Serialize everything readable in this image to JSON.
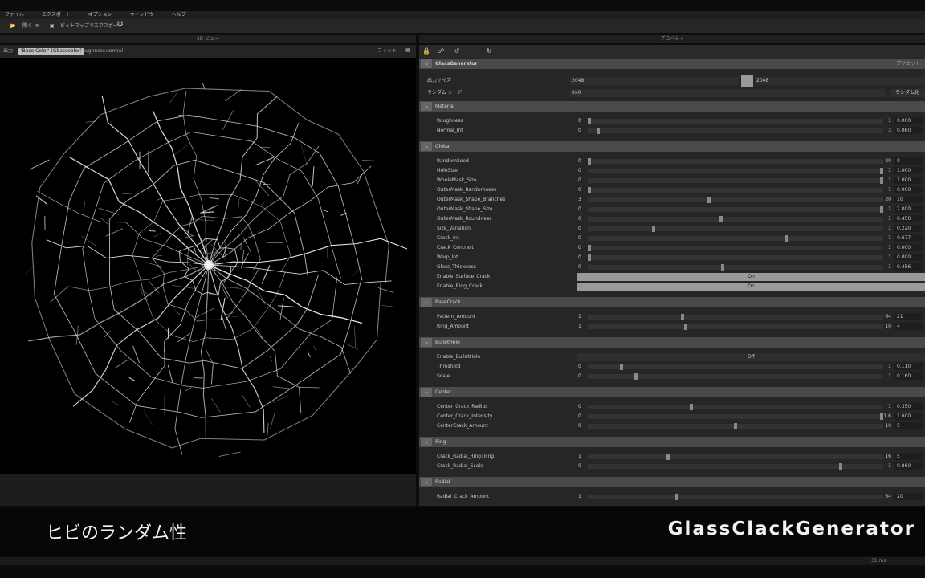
{
  "menu": [
    "ファイル",
    "エクスポート",
    "オプション",
    "ウィンドウ",
    "ヘルプ"
  ],
  "toolbar": {
    "open": "開く",
    "export": "ビットマップでエクスポート"
  },
  "left": {
    "title": "2D ビュー",
    "output_label": "出力",
    "output_chip": "'Base Color' (Gbasecolor)",
    "output_alt1": "roughness",
    "output_alt2": "normal",
    "fit": "フィット"
  },
  "right": {
    "title": "プロパティ",
    "graph": "GlassGenerator",
    "preset": "プリセット",
    "outsize_label": "出力サイズ",
    "outsize_a": "2048",
    "outsize_b": "2048",
    "seed_label": "ランダム シード",
    "seed_val": "0x0",
    "seed_btn": "ランダム化"
  },
  "sections": [
    {
      "name": "Material",
      "rows": [
        {
          "label": "Roughness",
          "min": "0",
          "max": "1",
          "value": "0.000",
          "pos": 0.0
        },
        {
          "label": "Normal_Int",
          "min": "0",
          "max": "3",
          "value": "0.080",
          "pos": 0.03
        }
      ]
    },
    {
      "name": "Global",
      "rows": [
        {
          "label": "RandomSeed",
          "min": "0",
          "max": "20",
          "value": "0",
          "pos": 0.0
        },
        {
          "label": "HoleSize",
          "min": "0",
          "max": "1",
          "value": "1.000",
          "pos": 1.0
        },
        {
          "label": "WholeMask_Size",
          "min": "0",
          "max": "1",
          "value": "1.000",
          "pos": 1.0
        },
        {
          "label": "OuterMask_Randomness",
          "min": "0",
          "max": "1",
          "value": "0.000",
          "pos": 0.0
        },
        {
          "label": "OuterMask_Shape_Branches",
          "min": "3",
          "max": "20",
          "value": "10",
          "pos": 0.41
        },
        {
          "label": "OuterMask_Shape_Size",
          "min": "0",
          "max": "2",
          "value": "2.000",
          "pos": 1.0
        },
        {
          "label": "OuterMask_Roundness",
          "min": "0",
          "max": "1",
          "value": "0.450",
          "pos": 0.45
        },
        {
          "label": "Size_Variation",
          "min": "0",
          "max": "1",
          "value": "0.220",
          "pos": 0.22
        },
        {
          "label": "Crack_Int",
          "min": "0",
          "max": "1",
          "value": "0.677",
          "pos": 0.677
        },
        {
          "label": "Crack_Contrast",
          "min": "0",
          "max": "1",
          "value": "0.000",
          "pos": 0.0
        },
        {
          "label": "Warp_Int",
          "min": "0",
          "max": "1",
          "value": "0.000",
          "pos": 0.0
        },
        {
          "label": "Glass_Thickness",
          "min": "0",
          "max": "1",
          "value": "0.456",
          "pos": 0.456
        },
        {
          "label": "Enable_Surface_Crack",
          "toggle": "On"
        },
        {
          "label": "Enable_Ring_Crack",
          "toggle": "On"
        }
      ]
    },
    {
      "name": "BaseCrack",
      "rows": [
        {
          "label": "Pattern_Amount",
          "min": "1",
          "max": "64",
          "value": "21",
          "pos": 0.32
        },
        {
          "label": "Ring_Amount",
          "min": "1",
          "max": "10",
          "value": "4",
          "pos": 0.33
        }
      ]
    },
    {
      "name": "BulletHole",
      "rows": [
        {
          "label": "Enable_BulletHole",
          "toggle": "Off"
        },
        {
          "label": "Threshold",
          "min": "0",
          "max": "1",
          "value": "0.110",
          "pos": 0.11
        },
        {
          "label": "Scale",
          "min": "0",
          "max": "1",
          "value": "0.160",
          "pos": 0.16
        }
      ]
    },
    {
      "name": "Center",
      "rows": [
        {
          "label": "Center_Crack_Radius",
          "min": "0",
          "max": "1",
          "value": "0.350",
          "pos": 0.35
        },
        {
          "label": "Center_Crack_Intensity",
          "min": "0",
          "max": "1.6",
          "value": "1.600",
          "pos": 1.0
        },
        {
          "label": "CenterCrack_Amount",
          "min": "0",
          "max": "10",
          "value": "5",
          "pos": 0.5
        }
      ]
    },
    {
      "name": "Ring",
      "rows": [
        {
          "label": "Crack_Radial_RingTiling",
          "min": "1",
          "max": "16",
          "value": "5",
          "pos": 0.27
        },
        {
          "label": "Crack_Radial_Scale",
          "min": "0",
          "max": "1",
          "value": "0.860",
          "pos": 0.86
        }
      ]
    },
    {
      "name": "Radial",
      "rows": [
        {
          "label": "Radial_Crack_Amount",
          "min": "1",
          "max": "64",
          "value": "20",
          "pos": 0.3
        }
      ]
    }
  ],
  "caption": {
    "left": "ヒビのランダム性",
    "right": "GlassClackGenerator"
  },
  "status": {
    "right": "31 ms"
  }
}
